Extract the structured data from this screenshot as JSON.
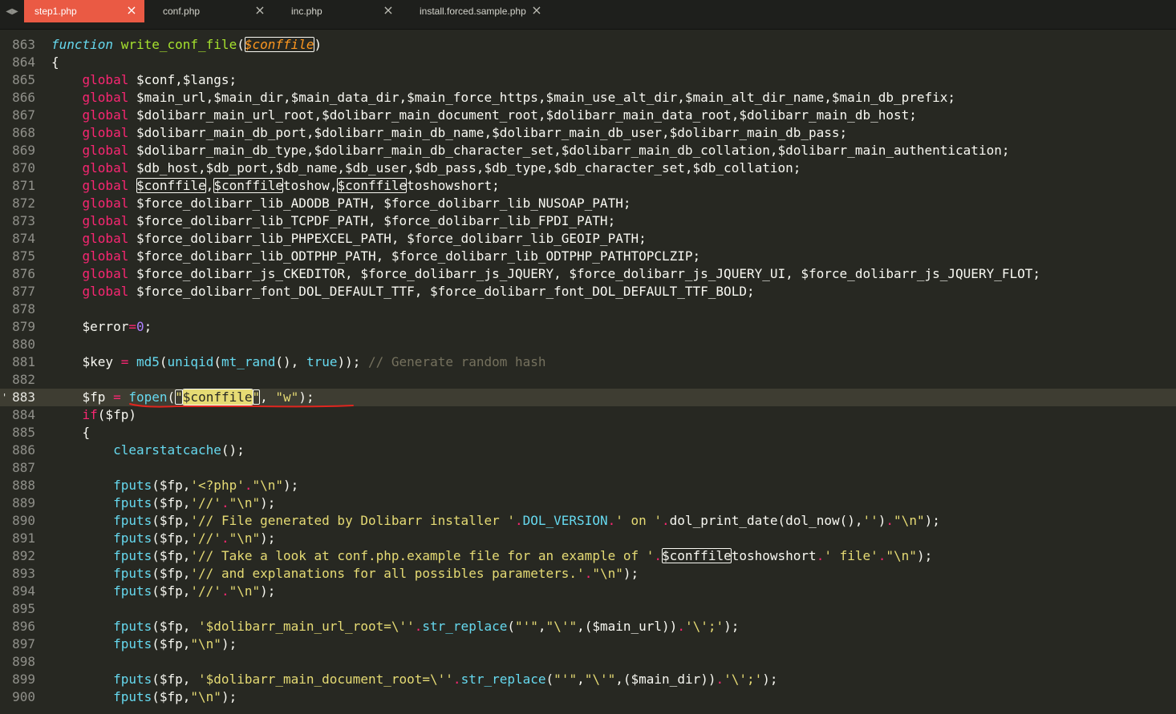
{
  "tabs": [
    {
      "label": "step1.php",
      "active": true
    },
    {
      "label": "conf.php",
      "active": false
    },
    {
      "label": "inc.php",
      "active": false
    },
    {
      "label": "install.forced.sample.php",
      "active": false
    }
  ],
  "editor": {
    "current_line": "883",
    "lines": [
      {
        "n": "863",
        "tokens": [
          [
            "function",
            "ital"
          ],
          [
            " ",
            ""
          ],
          [
            "write_conf_file",
            "fname"
          ],
          [
            "(",
            ""
          ],
          [
            "$conffile",
            "param hl"
          ],
          [
            ")",
            ""
          ]
        ]
      },
      {
        "n": "864",
        "tokens": [
          [
            "{",
            ""
          ]
        ]
      },
      {
        "n": "865",
        "tokens": [
          [
            "    ",
            ""
          ],
          [
            "global",
            "kw"
          ],
          [
            " $conf,$langs;",
            ""
          ]
        ]
      },
      {
        "n": "866",
        "tokens": [
          [
            "    ",
            ""
          ],
          [
            "global",
            "kw"
          ],
          [
            " $main_url,$main_dir,$main_data_dir,$main_force_https,$main_use_alt_dir,$main_alt_dir_name,$main_db_prefix;",
            ""
          ]
        ]
      },
      {
        "n": "867",
        "tokens": [
          [
            "    ",
            ""
          ],
          [
            "global",
            "kw"
          ],
          [
            " $dolibarr_main_url_root,$dolibarr_main_document_root,$dolibarr_main_data_root,$dolibarr_main_db_host;",
            ""
          ]
        ]
      },
      {
        "n": "868",
        "tokens": [
          [
            "    ",
            ""
          ],
          [
            "global",
            "kw"
          ],
          [
            " $dolibarr_main_db_port,$dolibarr_main_db_name,$dolibarr_main_db_user,$dolibarr_main_db_pass;",
            ""
          ]
        ]
      },
      {
        "n": "869",
        "tokens": [
          [
            "    ",
            ""
          ],
          [
            "global",
            "kw"
          ],
          [
            " $dolibarr_main_db_type,$dolibarr_main_db_character_set,$dolibarr_main_db_collation,$dolibarr_main_authentication;",
            ""
          ]
        ]
      },
      {
        "n": "870",
        "tokens": [
          [
            "    ",
            ""
          ],
          [
            "global",
            "kw"
          ],
          [
            " $db_host,$db_port,$db_name,$db_user,$db_pass,$db_type,$db_character_set,$db_collation;",
            ""
          ]
        ]
      },
      {
        "n": "871",
        "tokens": [
          [
            "    ",
            ""
          ],
          [
            "global",
            "kw"
          ],
          [
            " ",
            ""
          ],
          [
            "$conffile",
            "hl"
          ],
          [
            ",",
            ""
          ],
          [
            "$conffile",
            "hl"
          ],
          [
            "toshow,",
            ""
          ],
          [
            "$conffile",
            "hl"
          ],
          [
            "toshowshort;",
            ""
          ]
        ]
      },
      {
        "n": "872",
        "tokens": [
          [
            "    ",
            ""
          ],
          [
            "global",
            "kw"
          ],
          [
            " $force_dolibarr_lib_ADODB_PATH, $force_dolibarr_lib_NUSOAP_PATH;",
            ""
          ]
        ]
      },
      {
        "n": "873",
        "tokens": [
          [
            "    ",
            ""
          ],
          [
            "global",
            "kw"
          ],
          [
            " $force_dolibarr_lib_TCPDF_PATH, $force_dolibarr_lib_FPDI_PATH;",
            ""
          ]
        ]
      },
      {
        "n": "874",
        "tokens": [
          [
            "    ",
            ""
          ],
          [
            "global",
            "kw"
          ],
          [
            " $force_dolibarr_lib_PHPEXCEL_PATH, $force_dolibarr_lib_GEOIP_PATH;",
            ""
          ]
        ]
      },
      {
        "n": "875",
        "tokens": [
          [
            "    ",
            ""
          ],
          [
            "global",
            "kw"
          ],
          [
            " $force_dolibarr_lib_ODTPHP_PATH, $force_dolibarr_lib_ODTPHP_PATHTOPCLZIP;",
            ""
          ]
        ]
      },
      {
        "n": "876",
        "tokens": [
          [
            "    ",
            ""
          ],
          [
            "global",
            "kw"
          ],
          [
            " $force_dolibarr_js_CKEDITOR, $force_dolibarr_js_JQUERY, $force_dolibarr_js_JQUERY_UI, $force_dolibarr_js_JQUERY_FLOT;",
            ""
          ]
        ]
      },
      {
        "n": "877",
        "tokens": [
          [
            "    ",
            ""
          ],
          [
            "global",
            "kw"
          ],
          [
            " $force_dolibarr_font_DOL_DEFAULT_TTF, $force_dolibarr_font_DOL_DEFAULT_TTF_BOLD;",
            ""
          ]
        ]
      },
      {
        "n": "878",
        "tokens": []
      },
      {
        "n": "879",
        "tokens": [
          [
            "    $error",
            ""
          ],
          [
            "=",
            "kw"
          ],
          [
            "0",
            "num"
          ],
          [
            ";",
            ""
          ]
        ]
      },
      {
        "n": "880",
        "tokens": []
      },
      {
        "n": "881",
        "tokens": [
          [
            "    $key ",
            ""
          ],
          [
            "=",
            "kw"
          ],
          [
            " ",
            ""
          ],
          [
            "md5",
            "fn"
          ],
          [
            "(",
            ""
          ],
          [
            "uniqid",
            "fn"
          ],
          [
            "(",
            ""
          ],
          [
            "mt_rand",
            "fn"
          ],
          [
            "(), ",
            ""
          ],
          [
            "true",
            "fn"
          ],
          [
            ")); ",
            ""
          ],
          [
            "// Generate random hash",
            "cm"
          ]
        ]
      },
      {
        "n": "882",
        "tokens": []
      },
      {
        "n": "883",
        "tokens": [
          [
            "    $fp ",
            ""
          ],
          [
            "=",
            "kw"
          ],
          [
            " ",
            ""
          ],
          [
            "fopen",
            "fn"
          ],
          [
            "(",
            ""
          ],
          [
            "\"",
            "st hl"
          ],
          [
            "$conffile",
            "hl-sel"
          ],
          [
            "\"",
            "st hl"
          ],
          [
            ", ",
            ""
          ],
          [
            "\"w\"",
            "st"
          ],
          [
            ");",
            ""
          ]
        ]
      },
      {
        "n": "884",
        "tokens": [
          [
            "    ",
            ""
          ],
          [
            "if",
            "kw"
          ],
          [
            "($fp)",
            ""
          ]
        ]
      },
      {
        "n": "885",
        "tokens": [
          [
            "    {",
            ""
          ]
        ]
      },
      {
        "n": "886",
        "tokens": [
          [
            "        ",
            ""
          ],
          [
            "clearstatcache",
            "fn"
          ],
          [
            "();",
            ""
          ]
        ]
      },
      {
        "n": "887",
        "tokens": []
      },
      {
        "n": "888",
        "tokens": [
          [
            "        ",
            ""
          ],
          [
            "fputs",
            "fn"
          ],
          [
            "($fp,",
            ""
          ],
          [
            "'<?php'",
            "st"
          ],
          [
            ".",
            "kw"
          ],
          [
            "\"\\n\"",
            "st"
          ],
          [
            ");",
            ""
          ]
        ]
      },
      {
        "n": "889",
        "tokens": [
          [
            "        ",
            ""
          ],
          [
            "fputs",
            "fn"
          ],
          [
            "($fp,",
            ""
          ],
          [
            "'//'",
            "st"
          ],
          [
            ".",
            "kw"
          ],
          [
            "\"\\n\"",
            "st"
          ],
          [
            ");",
            ""
          ]
        ]
      },
      {
        "n": "890",
        "tokens": [
          [
            "        ",
            ""
          ],
          [
            "fputs",
            "fn"
          ],
          [
            "($fp,",
            ""
          ],
          [
            "'// File generated by Dolibarr installer '",
            "st"
          ],
          [
            ".",
            "kw"
          ],
          [
            "DOL_VERSION",
            "fn"
          ],
          [
            ".",
            "kw"
          ],
          [
            "' on '",
            "st"
          ],
          [
            ".",
            "kw"
          ],
          [
            "dol_print_date(dol_now(),",
            ""
          ],
          [
            "''",
            "st"
          ],
          [
            ")",
            ""
          ],
          [
            ".",
            "kw"
          ],
          [
            "\"\\n\"",
            "st"
          ],
          [
            ");",
            ""
          ]
        ]
      },
      {
        "n": "891",
        "tokens": [
          [
            "        ",
            ""
          ],
          [
            "fputs",
            "fn"
          ],
          [
            "($fp,",
            ""
          ],
          [
            "'//'",
            "st"
          ],
          [
            ".",
            "kw"
          ],
          [
            "\"\\n\"",
            "st"
          ],
          [
            ");",
            ""
          ]
        ]
      },
      {
        "n": "892",
        "tokens": [
          [
            "        ",
            ""
          ],
          [
            "fputs",
            "fn"
          ],
          [
            "($fp,",
            ""
          ],
          [
            "'// Take a look at conf.php.example file for an example of '",
            "st"
          ],
          [
            ".",
            "kw"
          ],
          [
            "$conffile",
            "hl"
          ],
          [
            "toshowshort",
            ""
          ],
          [
            ".",
            "kw"
          ],
          [
            "' file'",
            "st"
          ],
          [
            ".",
            "kw"
          ],
          [
            "\"\\n\"",
            "st"
          ],
          [
            ");",
            ""
          ]
        ]
      },
      {
        "n": "893",
        "tokens": [
          [
            "        ",
            ""
          ],
          [
            "fputs",
            "fn"
          ],
          [
            "($fp,",
            ""
          ],
          [
            "'// and explanations for all possibles parameters.'",
            "st"
          ],
          [
            ".",
            "kw"
          ],
          [
            "\"\\n\"",
            "st"
          ],
          [
            ");",
            ""
          ]
        ]
      },
      {
        "n": "894",
        "tokens": [
          [
            "        ",
            ""
          ],
          [
            "fputs",
            "fn"
          ],
          [
            "($fp,",
            ""
          ],
          [
            "'//'",
            "st"
          ],
          [
            ".",
            "kw"
          ],
          [
            "\"\\n\"",
            "st"
          ],
          [
            ");",
            ""
          ]
        ]
      },
      {
        "n": "895",
        "tokens": []
      },
      {
        "n": "896",
        "tokens": [
          [
            "        ",
            ""
          ],
          [
            "fputs",
            "fn"
          ],
          [
            "($fp, ",
            ""
          ],
          [
            "'$dolibarr_main_url_root=\\''",
            "st"
          ],
          [
            ".",
            "kw"
          ],
          [
            "str_replace",
            "fn"
          ],
          [
            "(",
            ""
          ],
          [
            "\"'\"",
            "st"
          ],
          [
            ",",
            ""
          ],
          [
            "\"\\'\"",
            "st"
          ],
          [
            ",($main_url))",
            ""
          ],
          [
            ".",
            "kw"
          ],
          [
            "'\\';'",
            "st"
          ],
          [
            ");",
            ""
          ]
        ]
      },
      {
        "n": "897",
        "tokens": [
          [
            "        ",
            ""
          ],
          [
            "fputs",
            "fn"
          ],
          [
            "($fp,",
            ""
          ],
          [
            "\"\\n\"",
            "st"
          ],
          [
            ");",
            ""
          ]
        ]
      },
      {
        "n": "898",
        "tokens": []
      },
      {
        "n": "899",
        "tokens": [
          [
            "        ",
            ""
          ],
          [
            "fputs",
            "fn"
          ],
          [
            "($fp, ",
            ""
          ],
          [
            "'$dolibarr_main_document_root=\\''",
            "st"
          ],
          [
            ".",
            "kw"
          ],
          [
            "str_replace",
            "fn"
          ],
          [
            "(",
            ""
          ],
          [
            "\"'\"",
            "st"
          ],
          [
            ",",
            ""
          ],
          [
            "\"\\'\"",
            "st"
          ],
          [
            ",($main_dir))",
            ""
          ],
          [
            ".",
            "kw"
          ],
          [
            "'\\';'",
            "st"
          ],
          [
            ");",
            ""
          ]
        ]
      },
      {
        "n": "900",
        "tokens": [
          [
            "        ",
            ""
          ],
          [
            "fputs",
            "fn"
          ],
          [
            "($fp,",
            ""
          ],
          [
            "\"\\n\"",
            "st"
          ],
          [
            ");",
            ""
          ]
        ]
      }
    ]
  }
}
